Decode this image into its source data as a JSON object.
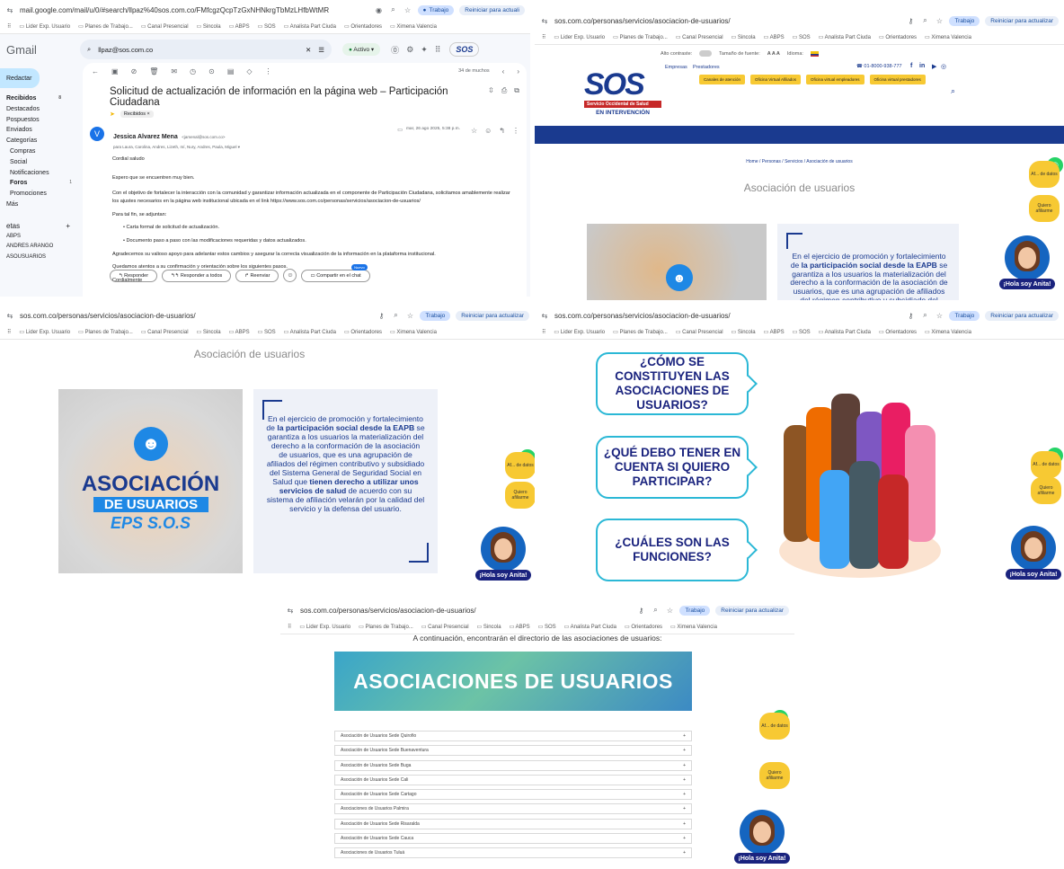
{
  "gmail": {
    "url": "mail.google.com/mail/u/0/#search/llpaz%40sos.com.co/FMfcgzQcpTzGxNHNkrgTbMzLHfbWtMR",
    "profile_label": "Trabajo",
    "restart_label": "Reiniciar para actuali",
    "bookmarks": [
      "Lider Exp. Usuario",
      "Planes de Trabajo...",
      "Canal Presencial",
      "Sincola",
      "ABPS",
      "SOS",
      "Analista Part Ciuda",
      "Orientadores",
      "Ximena Valencia"
    ],
    "logo": "Gmail",
    "search_value": "llpaz@sos.com.co",
    "status": "Activo",
    "compose": "Redactar",
    "nav": [
      "Recibidos",
      "Destacados",
      "Pospuestos",
      "Enviados",
      "Categorías",
      "Compras",
      "Social",
      "Notificaciones",
      "Foros",
      "Promociones",
      "Más"
    ],
    "nav_counts": {
      "recibidos": "8",
      "foros": "1"
    },
    "labels_title": "etas",
    "labels": [
      "ABPS",
      "ANDRES ARANGO",
      "ASOUSUARIOS"
    ],
    "pagination": "34 de muchos",
    "subject": "Solicitud de actualización de información en la página web – Participación Ciudadana",
    "chip": "Recibidos ×",
    "sender": "Jessica Alvarez Mena",
    "sender_email": "<jamenal@sos.com.co>",
    "recipients": "para Laura, Carolina, Andres, Lizeth, mí, Nury, Andres, Paula, Miguel",
    "date": "mar, 26 ago 2025, 5:38 p.m.",
    "avatar_letter": "V",
    "body": [
      "Cordial saludo",
      "Espero que se encuentren muy bien.",
      "Con el objetivo de fortalecer la interacción con la comunidad y garantizar información actualizada en el componente de Participación Ciudadana, solicitamos amablemente realizar los ajustes necesarios en la página web institucional ubicada en el link https://www.sos.com.co/personas/servicios/asociacion-de-usuarios/",
      "Para tal fin, se adjuntan:",
      "Agradecemos su valioso apoyo para adelantar estos cambios y asegurar la correcta visualización de la información en la plataforma institucional.",
      "Quedamos atentos a su confirmación y orientación sobre los siguientes pasos.",
      "Cordialmente"
    ],
    "bullets": [
      "Carta formal de solicitud de actualización.",
      "Documento paso a paso con las modificaciones requeridas y datos actualizados."
    ],
    "actions": [
      "Responder",
      "Responder a todos",
      "Reenviar",
      "Compartir en el chat"
    ],
    "new_badge": "Nuevo"
  },
  "sos": {
    "url": "sos.com.co/personas/servicios/asociacion-de-usuarios/",
    "profile_label": "Trabajo",
    "restart_label": "Reiniciar para actualizar",
    "bookmarks": [
      "Lider Exp. Usuario",
      "Planes de Trabajo...",
      "Canal Presencial",
      "Sincola",
      "ABPS",
      "SOS",
      "Analista Part Ciuda",
      "Orientadores",
      "Ximena Valencia"
    ],
    "contrast_label": "Alto contraste:",
    "font_size_label": "Tamaño de fuente:",
    "font_size_controls": "A A A",
    "language_label": "Idioma:",
    "top_links": [
      "Empresas",
      "Prestadores"
    ],
    "phone": "01-8000-938-777",
    "social": [
      "f",
      "in"
    ],
    "yellow_buttons": [
      "Canales de atención",
      "Oficina Virtual Afiliados",
      "Oficina virtual empleadores",
      "Oficina virtual prestadores"
    ],
    "logo_text": "SOS",
    "logo_sub": "Servicio Occidental de Salud",
    "logo_banner": "EN INTERVENCIÓN",
    "breadcrumb": [
      "Home",
      "Personas",
      "Servicios",
      "Asociación de usuarios"
    ],
    "page_title": "Asociación de usuarios",
    "image_title_1": "ASOCIACIÓN",
    "image_title_2": "DE USUARIOS",
    "image_title_3": "EPS S.O.S",
    "paragraph_pre": "En el ejercicio de promoción y fortalecimiento de ",
    "paragraph_bold1": "la participación social desde la EAPB",
    "paragraph_mid": " se garantiza a los usuarios la materialización del derecho a la conformación de la asociación de usuarios, que es una agrupación de afiliados del régimen contributivo y subsidiado del Sistema General de Seguridad Social en Salud que ",
    "paragraph_bold2": "tienen derecho a utilizar unos servicios de salud",
    "paragraph_post": " de acuerdo con su sistema de afiliación velarán por la calidad del servicio y la defensa del usuario.",
    "chat_button": "Quiero afiliarme",
    "chat_button_top": "Af... de datos",
    "anita": "¡Hola soy Anita!",
    "bubbles": [
      "¿CÓMO SE CONSTITUYEN LAS ASOCIACIONES DE USUARIOS?",
      "¿QUÉ DEBO TENER EN CUENTA SI QUIERO PARTICIPAR?",
      "¿CUÁLES SON LAS FUNCIONES?"
    ],
    "directory_intro": "A continuación, encontrarán el directorio de las asociaciones de usuarios:",
    "banner_title": "ASOCIACIONES DE USUARIOS",
    "directory": [
      "Asociación de Usuarios Sede Quirofio",
      "Asociación de Usuarios Sede Buenaventura",
      "Asociación de Usuarios Sede Buga",
      "Asociación de Usuarios Sede Cali",
      "Asociación de Usuarios Sede Cartago",
      "Asociaciones de Usuarios Palmira",
      "Asociación de Usuarios Sede Risaralda",
      "Asociación de Usuarios Sede Cauca",
      "Asociaciones de Usuarios Tuluá"
    ],
    "expand_symbol": "+"
  },
  "colors": {
    "brand_blue": "#1a3a8f",
    "yellow": "#f7c933",
    "teal": "#2bb8d6",
    "gmail_chip": "#c2e7ff"
  }
}
